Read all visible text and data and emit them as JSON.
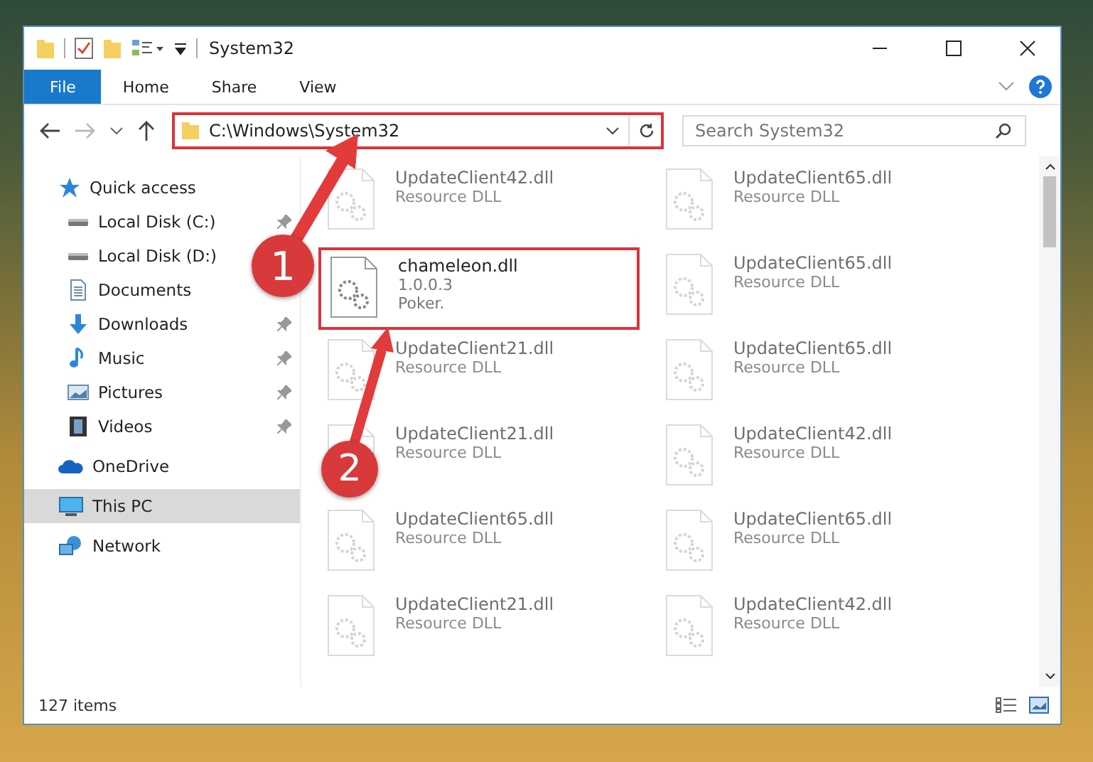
{
  "window": {
    "title": "System32"
  },
  "ribbon": {
    "tabs": [
      {
        "label": "File",
        "selected": true
      },
      {
        "label": "Home",
        "selected": false
      },
      {
        "label": "Share",
        "selected": false
      },
      {
        "label": "View",
        "selected": false
      }
    ]
  },
  "address_bar": {
    "path": "C:\\Windows\\System32",
    "highlighted": true
  },
  "search": {
    "placeholder": "Search System32"
  },
  "sidebar": {
    "groups": [
      {
        "label": "Quick access",
        "selected": false,
        "children": [
          {
            "label": "Local Disk (C:)",
            "pinned": true
          },
          {
            "label": "Local Disk (D:)",
            "pinned": false
          },
          {
            "label": "Documents",
            "pinned": false
          },
          {
            "label": "Downloads",
            "pinned": true
          },
          {
            "label": "Music",
            "pinned": true
          },
          {
            "label": "Pictures",
            "pinned": true
          },
          {
            "label": "Videos",
            "pinned": true
          }
        ]
      },
      {
        "label": "OneDrive",
        "selected": false
      },
      {
        "label": "This PC",
        "selected": true
      },
      {
        "label": "Network",
        "selected": false
      }
    ]
  },
  "files": [
    {
      "name": "UpdateClient42.dll",
      "lines": [
        "Resource DLL"
      ],
      "kind": "faded",
      "highlighted": false
    },
    {
      "name": "UpdateClient65.dll",
      "lines": [
        "Resource DLL"
      ],
      "kind": "faded",
      "highlighted": false
    },
    {
      "name": "chameleon.dll",
      "lines": [
        "1.0.0.3",
        "Poker."
      ],
      "kind": "normal",
      "highlighted": true
    },
    {
      "name": "UpdateClient65.dll",
      "lines": [
        "Resource DLL"
      ],
      "kind": "faded",
      "highlighted": false
    },
    {
      "name": "UpdateClient21.dll",
      "lines": [
        "Resource DLL"
      ],
      "kind": "faded",
      "highlighted": false
    },
    {
      "name": "UpdateClient65.dll",
      "lines": [
        "Resource DLL"
      ],
      "kind": "faded",
      "highlighted": false
    },
    {
      "name": "UpdateClient21.dll",
      "lines": [
        "Resource DLL"
      ],
      "kind": "faded",
      "highlighted": false
    },
    {
      "name": "UpdateClient42.dll",
      "lines": [
        "Resource DLL"
      ],
      "kind": "faded",
      "highlighted": false
    },
    {
      "name": "UpdateClient65.dll",
      "lines": [
        "Resource DLL"
      ],
      "kind": "faded",
      "highlighted": false
    },
    {
      "name": "UpdateClient65.dll",
      "lines": [
        "Resource DLL"
      ],
      "kind": "faded",
      "highlighted": false
    },
    {
      "name": "UpdateClient21.dll",
      "lines": [
        "Resource DLL"
      ],
      "kind": "faded",
      "highlighted": false
    },
    {
      "name": "UpdateClient42.dll",
      "lines": [
        "Resource DLL"
      ],
      "kind": "faded",
      "highlighted": false
    }
  ],
  "status_bar": {
    "item_count": "127 items"
  },
  "callouts": [
    {
      "label": "1"
    },
    {
      "label": "2"
    }
  ]
}
